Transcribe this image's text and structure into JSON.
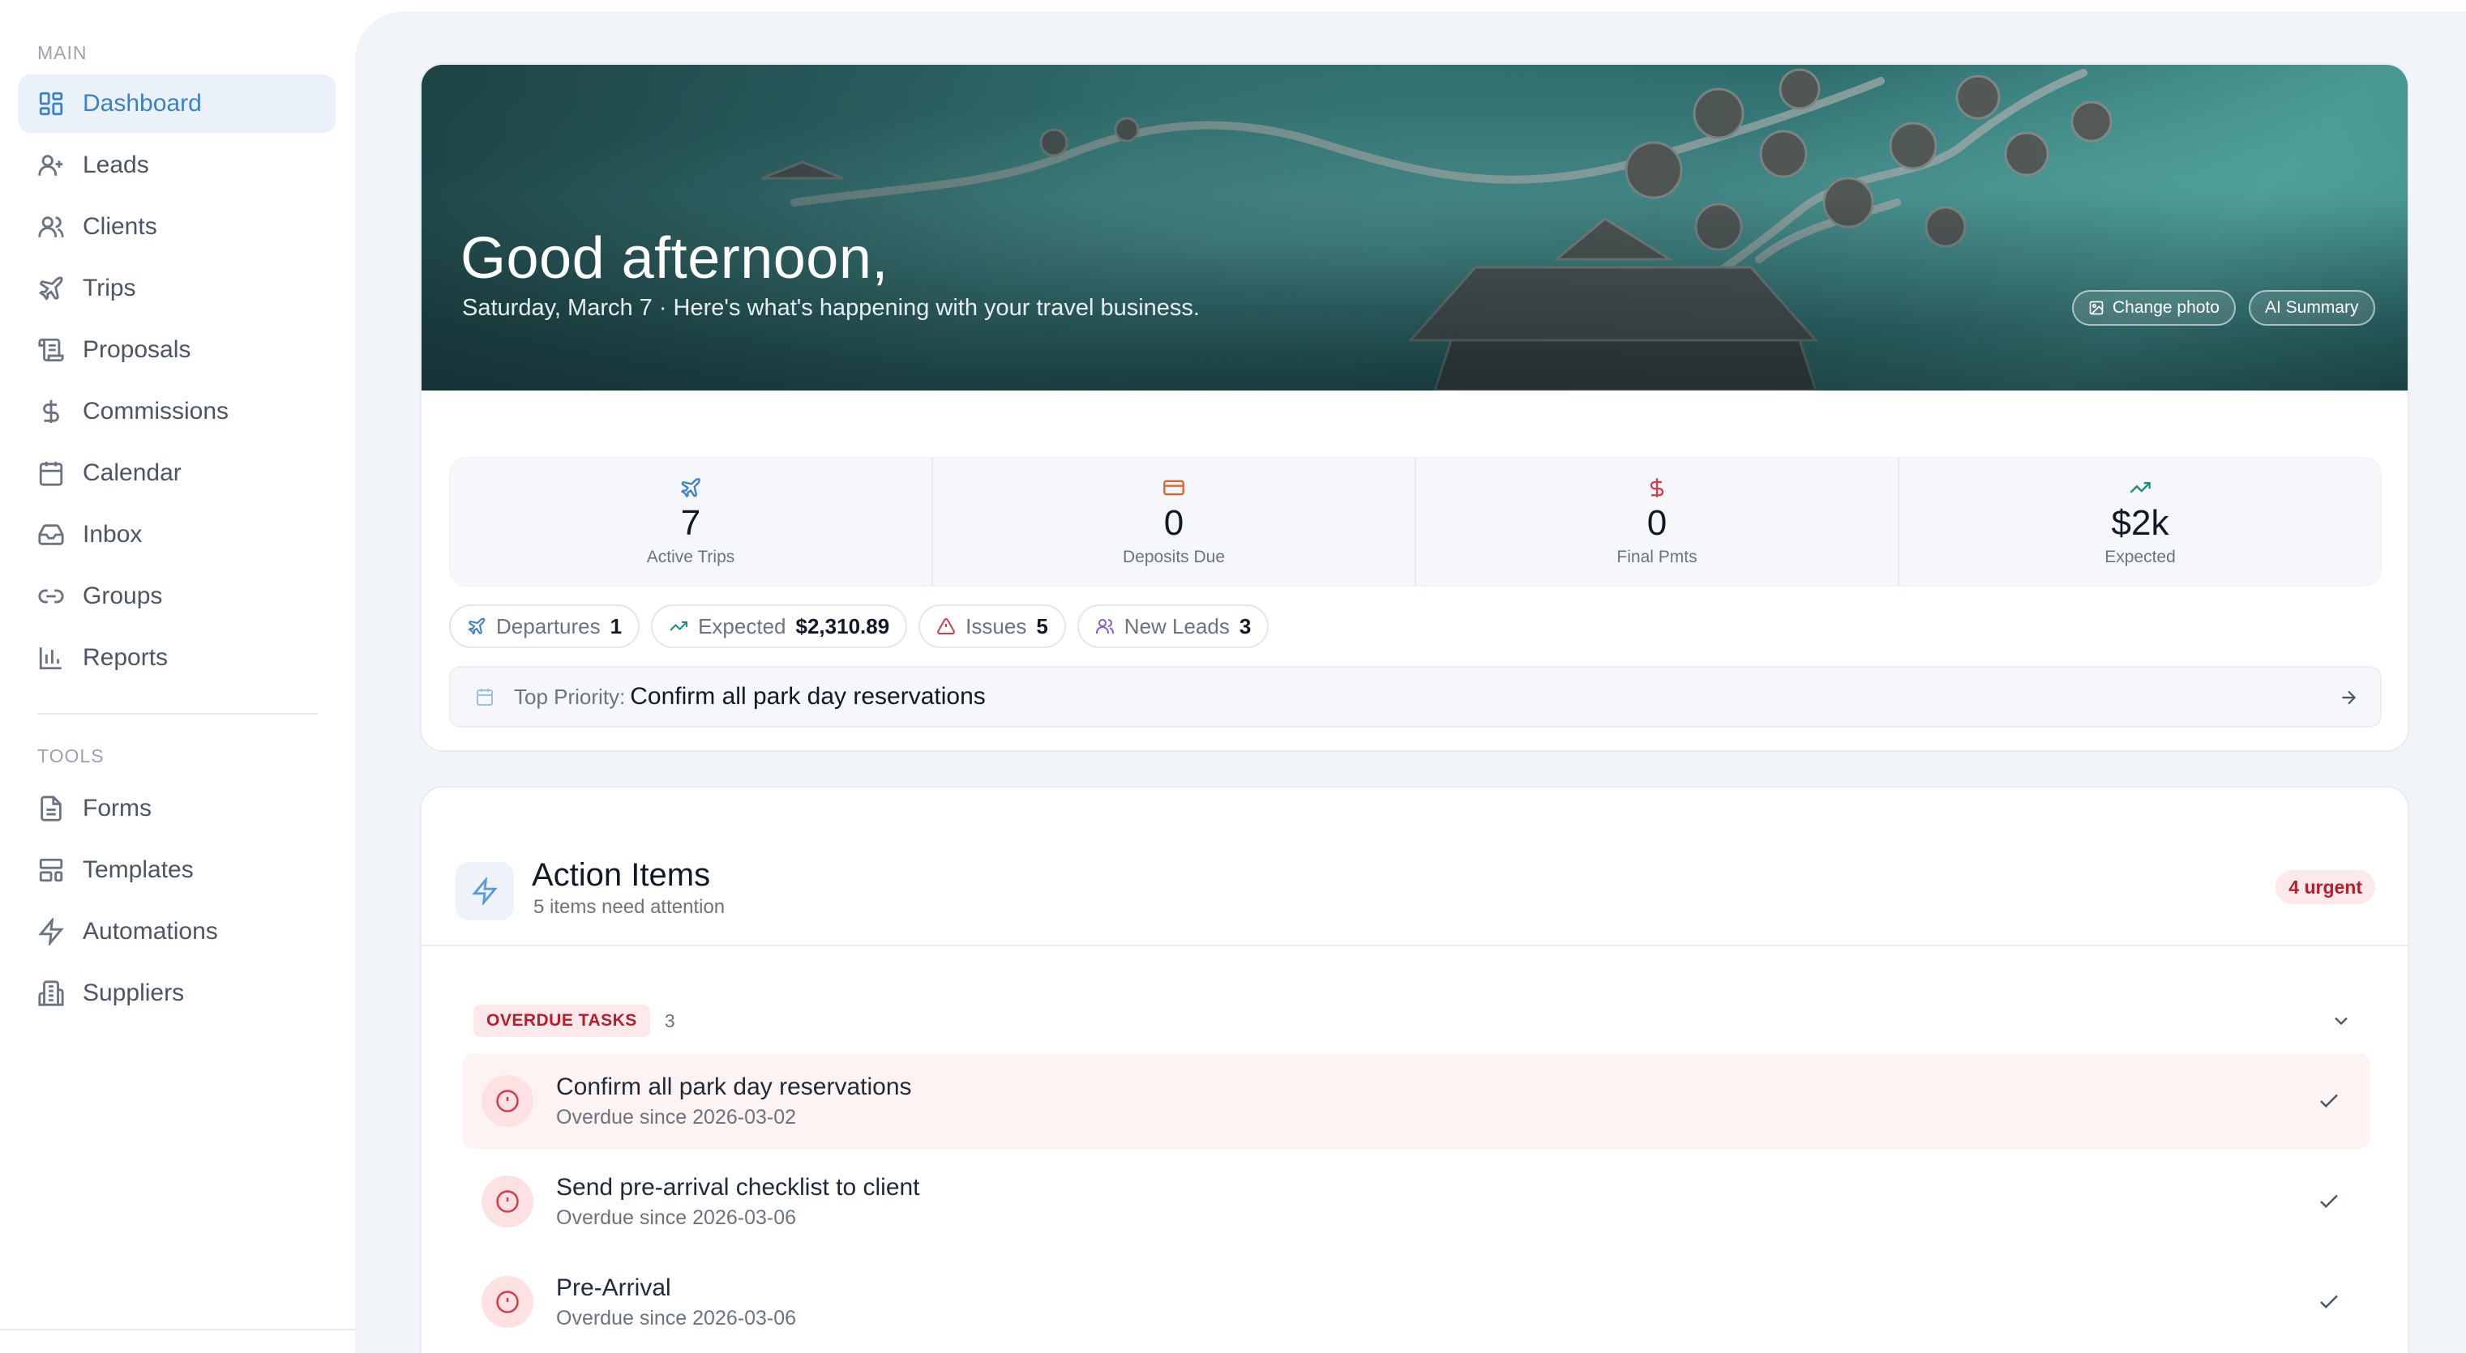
{
  "sidebar": {
    "main_label": "MAIN",
    "tools_label": "TOOLS",
    "main_items": [
      {
        "label": "Dashboard",
        "icon": "dashboard-icon",
        "active": true
      },
      {
        "label": "Leads",
        "icon": "user-plus-icon"
      },
      {
        "label": "Clients",
        "icon": "users-icon"
      },
      {
        "label": "Trips",
        "icon": "plane-icon"
      },
      {
        "label": "Proposals",
        "icon": "scroll-icon"
      },
      {
        "label": "Commissions",
        "icon": "dollar-icon"
      },
      {
        "label": "Calendar",
        "icon": "calendar-icon"
      },
      {
        "label": "Inbox",
        "icon": "inbox-icon"
      },
      {
        "label": "Groups",
        "icon": "link-icon"
      },
      {
        "label": "Reports",
        "icon": "bar-chart-icon"
      }
    ],
    "tool_items": [
      {
        "label": "Forms",
        "icon": "file-icon"
      },
      {
        "label": "Templates",
        "icon": "template-icon"
      },
      {
        "label": "Automations",
        "icon": "bolt-icon"
      },
      {
        "label": "Suppliers",
        "icon": "building-icon"
      }
    ]
  },
  "hero": {
    "greeting": "Good afternoon,",
    "subtitle": "Saturday, March 7 · Here's what's happening with your travel business.",
    "change_photo_label": "Change photo",
    "ai_summary_label": "AI Summary"
  },
  "stats": [
    {
      "value": "7",
      "label": "Active Trips",
      "icon": "plane-icon",
      "color": "#3b82c4"
    },
    {
      "value": "0",
      "label": "Deposits Due",
      "icon": "credit-card-icon",
      "color": "#e0632a"
    },
    {
      "value": "0",
      "label": "Final Pmts",
      "icon": "dollar-icon",
      "color": "#d43c4a"
    },
    {
      "value": "$2k",
      "label": "Expected",
      "icon": "trending-up-icon",
      "color": "#1f8a7a"
    }
  ],
  "pills": [
    {
      "label": "Departures",
      "value": "1",
      "icon": "plane-icon"
    },
    {
      "label": "Expected",
      "value": "$2,310.89",
      "icon": "trending-up-icon"
    },
    {
      "label": "Issues",
      "value": "5",
      "icon": "alert-triangle-icon"
    },
    {
      "label": "New Leads",
      "value": "3",
      "icon": "users-icon"
    }
  ],
  "priority": {
    "label": "Top Priority:",
    "text": "Confirm all park day reservations"
  },
  "action_items": {
    "title": "Action Items",
    "subtitle": "5 items need attention",
    "urgent_badge": "4 urgent",
    "group_label": "OVERDUE TASKS",
    "group_count": "3",
    "tasks": [
      {
        "title": "Confirm all park day reservations",
        "sub": "Overdue since 2026-03-02"
      },
      {
        "title": "Send pre-arrival checklist to client",
        "sub": "Overdue since 2026-03-06"
      },
      {
        "title": "Pre-Arrival",
        "sub": "Overdue since 2026-03-06"
      }
    ]
  },
  "colors": {
    "accent": "#3b82c4",
    "danger": "#b91c2b",
    "danger_bg": "#fde8ea"
  }
}
